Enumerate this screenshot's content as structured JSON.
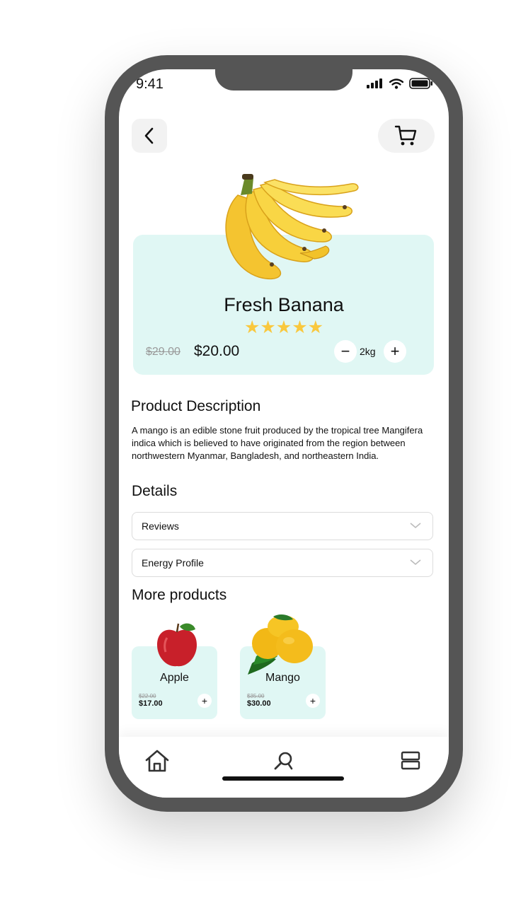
{
  "status_bar": {
    "time": "9:41"
  },
  "header": {
    "back_icon": "chevron-left-icon",
    "cart_icon": "cart-icon"
  },
  "product": {
    "name": "Fresh Banana",
    "rating_stars": "★★★★★",
    "rating": 5,
    "old_price": "$29.00",
    "price": "$20.00",
    "quantity": "2kg",
    "minus_label": "−",
    "plus_label": "+"
  },
  "description": {
    "title": "Product Description",
    "body": "A mango is an edible stone fruit produced by the tropical tree Mangifera indica which is believed to have originated from the region between northwestern Myanmar, Bangladesh, and northeastern India."
  },
  "details": {
    "title": "Details",
    "sections": [
      {
        "label": "Reviews"
      },
      {
        "label": "Energy Profile"
      }
    ]
  },
  "more_products": {
    "title": "More products",
    "items": [
      {
        "name": "Apple",
        "old_price": "$22.00",
        "price": "$17.00",
        "add_label": "+"
      },
      {
        "name": "Mango",
        "old_price": "$35.00",
        "price": "$30.00",
        "add_label": "+"
      }
    ]
  },
  "bottom_nav": {
    "items": [
      "home-icon",
      "search-icon",
      "list-icon"
    ]
  },
  "colors": {
    "card_bg": "#e0f7f4",
    "star": "#f9c83e",
    "frame": "#555555"
  }
}
